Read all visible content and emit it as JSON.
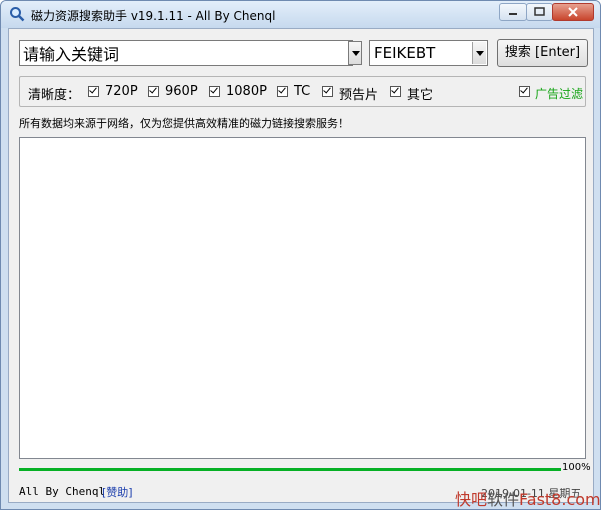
{
  "window": {
    "title": "磁力资源搜索助手 v19.1.11 - All By Chenql"
  },
  "search": {
    "placeholder": "请输入关键词",
    "value": "请输入关键词",
    "source": "FEIKEBT",
    "button": "搜索 [Enter]"
  },
  "filters": {
    "label": "清晰度：",
    "options": [
      {
        "label": "720P",
        "checked": true
      },
      {
        "label": "960P",
        "checked": true
      },
      {
        "label": "1080P",
        "checked": true
      },
      {
        "label": "TC",
        "checked": true
      },
      {
        "label": "预告片",
        "checked": true
      },
      {
        "label": "其它",
        "checked": true
      }
    ],
    "ad_filter": {
      "label": "广告过滤",
      "checked": true
    }
  },
  "notice": "所有数据均来源于网络，仅为您提供高效精准的磁力链接搜索服务！",
  "results": [],
  "progress": {
    "value": 100,
    "text": "100%"
  },
  "status": {
    "left": "All By Chenql",
    "donate": "[赞助]",
    "right": "2019-01-11 星期五"
  },
  "watermark": {
    "part1": "快吧",
    "part2": "软件",
    "part3": "Fast8.com"
  },
  "colors": {
    "progress": "#06b025",
    "ad_filter": "#16a516",
    "donate": "#1a3dac"
  }
}
